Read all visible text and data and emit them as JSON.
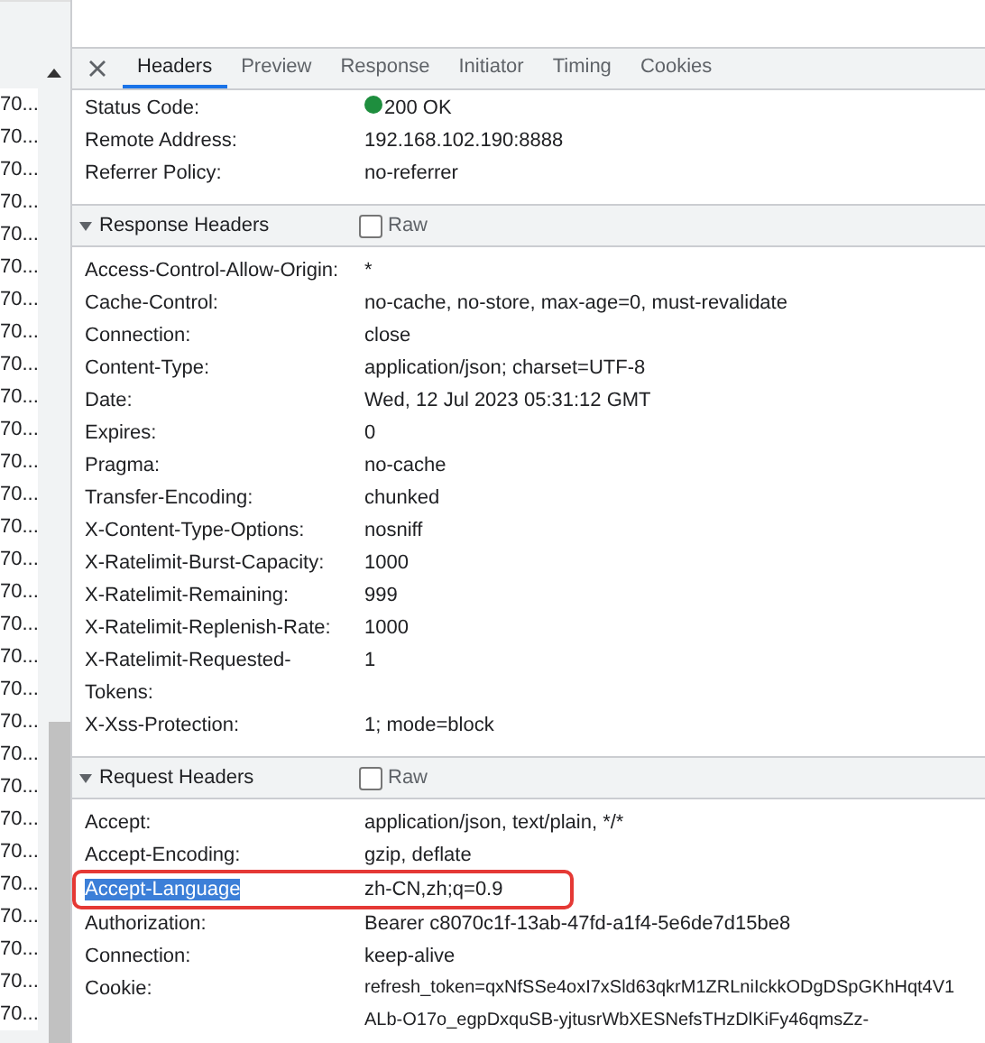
{
  "request_list": {
    "rows": [
      "70...",
      "70...",
      "70...",
      "70...",
      "70...",
      "70...",
      "70...",
      "70...",
      "70...",
      "70...",
      "70...",
      "70...",
      "70...",
      "70...",
      "70...",
      "70...",
      "70...",
      "70...",
      "70...",
      "70...",
      "70...",
      "70...",
      "70...",
      "70...",
      "70...",
      "70...",
      "70...",
      "70...",
      "70..."
    ]
  },
  "tabs": [
    {
      "label": "Headers",
      "selected": true
    },
    {
      "label": "Preview",
      "selected": false
    },
    {
      "label": "Response",
      "selected": false
    },
    {
      "label": "Initiator",
      "selected": false
    },
    {
      "label": "Timing",
      "selected": false
    },
    {
      "label": "Cookies",
      "selected": false
    }
  ],
  "general": [
    {
      "name": "Status Code:",
      "value": "200 OK",
      "color": "#1e8e3e"
    },
    {
      "name": "Remote Address:",
      "value": "192.168.102.190:8888"
    },
    {
      "name": "Referrer Policy:",
      "value": "no-referrer"
    }
  ],
  "sections": [
    {
      "title": "Response Headers",
      "expanded": true,
      "raw_label": "Raw",
      "raw_checked": false,
      "headers": [
        {
          "name": "Access-Control-Allow-Origin:",
          "value": "*",
          "highlighted": false
        },
        {
          "name": "Cache-Control:",
          "value": "no-cache, no-store, max-age=0, must-revalidate",
          "highlighted": false
        },
        {
          "name": "Connection:",
          "value": "close",
          "highlighted": false
        },
        {
          "name": "Content-Type:",
          "value": "application/json; charset=UTF-8",
          "highlighted": false
        },
        {
          "name": "Date:",
          "value": "Wed, 12 Jul 2023 05:31:12 GMT",
          "highlighted": false
        },
        {
          "name": "Expires:",
          "value": "0",
          "highlighted": false
        },
        {
          "name": "Pragma:",
          "value": "no-cache",
          "highlighted": false
        },
        {
          "name": "Transfer-Encoding:",
          "value": "chunked",
          "highlighted": false
        },
        {
          "name": "X-Content-Type-Options:",
          "value": "nosniff",
          "highlighted": false
        },
        {
          "name": "X-Ratelimit-Burst-Capacity:",
          "value": "1000",
          "highlighted": false
        },
        {
          "name": "X-Ratelimit-Remaining:",
          "value": "999",
          "highlighted": false
        },
        {
          "name": "X-Ratelimit-Replenish-Rate:",
          "value": "1000",
          "highlighted": false
        },
        {
          "name": "X-Ratelimit-Requested-Tokens:",
          "value": "1",
          "highlighted": false
        },
        {
          "name": "X-Xss-Protection:",
          "value": "1; mode=block",
          "highlighted": false
        }
      ]
    },
    {
      "title": "Request Headers",
      "expanded": true,
      "raw_label": "Raw",
      "raw_checked": false,
      "headers": [
        {
          "name": "Accept:",
          "value": "application/json, text/plain, */*",
          "highlighted": false
        },
        {
          "name": "Accept-Encoding:",
          "value": "gzip, deflate",
          "highlighted": false
        },
        {
          "name": "Accept-Language",
          "value": "zh-CN,zh;q=0.9",
          "highlighted": true
        },
        {
          "name": "Authorization:",
          "value": "Bearer c8070c1f-13ab-47fd-a1f4-5e6de7d15be8",
          "highlighted": false
        },
        {
          "name": "Connection:",
          "value": "keep-alive",
          "highlighted": false
        },
        {
          "name": "Cookie:",
          "value_lines": [
            "refresh_token=qxNfSSe4oxI7xSld63qkrM1ZRLniIckkODgDSpGKhHqt4V1",
            "ALb-O17o_egpDxquSB-yjtusrWbXESNefsTHzDlKiFy46qmsZz-"
          ],
          "highlighted": false
        }
      ]
    }
  ]
}
